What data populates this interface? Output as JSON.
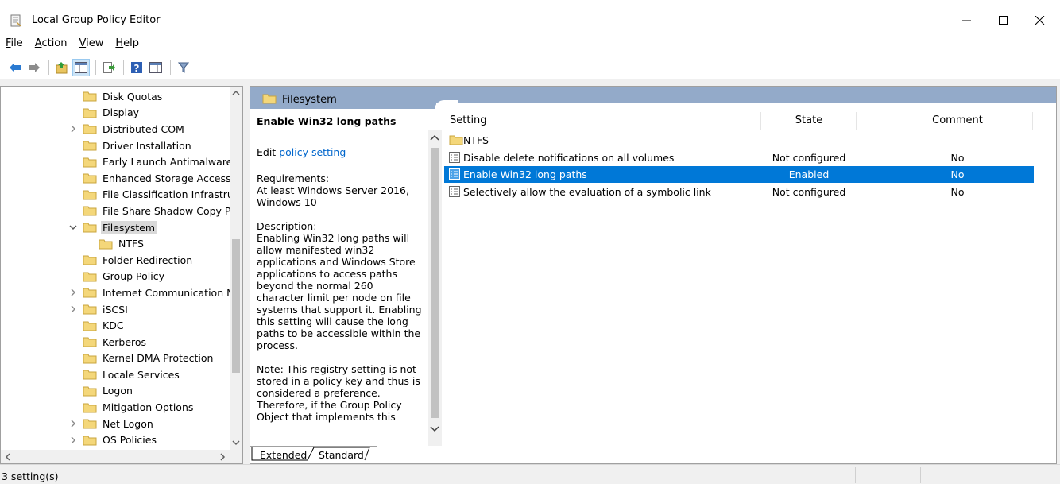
{
  "window": {
    "title": "Local Group Policy Editor",
    "icon": "policy-editor-icon",
    "controls": [
      "minimize-icon",
      "maximize-icon",
      "close-icon"
    ]
  },
  "menu": {
    "items": [
      {
        "label": "File",
        "accel": "F",
        "rest": "ile"
      },
      {
        "label": "Action",
        "accel": "A",
        "rest": "ction"
      },
      {
        "label": "View",
        "accel": "V",
        "rest": "iew"
      },
      {
        "label": "Help",
        "accel": "H",
        "rest": "elp"
      }
    ]
  },
  "toolbar": {
    "buttons": [
      "back-arrow-icon",
      "forward-arrow-icon",
      "up-folder-icon",
      "show-hide-tree-icon",
      "export-list-icon",
      "help-icon",
      "properties-view-icon",
      "filter-icon"
    ]
  },
  "tree": {
    "items": [
      {
        "label": "Disk Quotas",
        "expandable": false,
        "level": 0
      },
      {
        "label": "Display",
        "expandable": false,
        "level": 0
      },
      {
        "label": "Distributed COM",
        "expandable": true,
        "level": 0
      },
      {
        "label": "Driver Installation",
        "expandable": false,
        "level": 0
      },
      {
        "label": "Early Launch Antimalware",
        "expandable": false,
        "level": 0
      },
      {
        "label": "Enhanced Storage Access",
        "expandable": false,
        "level": 0
      },
      {
        "label": "File Classification Infrastruc",
        "expandable": false,
        "level": 0
      },
      {
        "label": "File Share Shadow Copy Pr",
        "expandable": false,
        "level": 0
      },
      {
        "label": "Filesystem",
        "expandable": true,
        "expanded": true,
        "selected": true,
        "level": 0
      },
      {
        "label": "NTFS",
        "expandable": false,
        "level": 1
      },
      {
        "label": "Folder Redirection",
        "expandable": false,
        "level": 0
      },
      {
        "label": "Group Policy",
        "expandable": false,
        "level": 0
      },
      {
        "label": "Internet Communication M",
        "expandable": true,
        "level": 0
      },
      {
        "label": "iSCSI",
        "expandable": true,
        "level": 0
      },
      {
        "label": "KDC",
        "expandable": false,
        "level": 0
      },
      {
        "label": "Kerberos",
        "expandable": false,
        "level": 0
      },
      {
        "label": "Kernel DMA Protection",
        "expandable": false,
        "level": 0
      },
      {
        "label": "Locale Services",
        "expandable": false,
        "level": 0
      },
      {
        "label": "Logon",
        "expandable": false,
        "level": 0
      },
      {
        "label": "Mitigation Options",
        "expandable": false,
        "level": 0
      },
      {
        "label": "Net Logon",
        "expandable": true,
        "level": 0
      },
      {
        "label": "OS Policies",
        "expandable": true,
        "level": 0
      }
    ]
  },
  "right": {
    "header": "Filesystem",
    "description": {
      "title": "Enable Win32 long paths",
      "edit_prefix": "Edit ",
      "edit_link": "policy setting ",
      "requirements_label": "Requirements:",
      "requirements": "At least Windows Server 2016, Windows 10",
      "description_label": "Description:",
      "description": "Enabling Win32 long paths will allow manifested win32 applications and Windows Store applications to access paths beyond the normal 260 character limit per node on file systems that support it.  Enabling this setting will cause the long paths to be accessible within the process.",
      "note": "Note:  This registry setting is not stored in a policy key and thus is considered a preference. Therefore, if the Group Policy Object that implements this"
    },
    "columns": {
      "setting": "Setting",
      "state": "State",
      "comment": "Comment"
    },
    "rows": [
      {
        "type": "folder",
        "name": "NTFS",
        "state": "",
        "comment": ""
      },
      {
        "type": "setting",
        "name": "Disable delete notifications on all volumes",
        "state": "Not configured",
        "comment": "No"
      },
      {
        "type": "setting",
        "name": "Enable Win32 long paths",
        "state": "Enabled",
        "comment": "No",
        "selected": true
      },
      {
        "type": "setting",
        "name": "Selectively allow the evaluation of a symbolic link",
        "state": "Not configured",
        "comment": "No"
      }
    ],
    "tabs": {
      "extended": "Extended",
      "standard": "Standard"
    }
  },
  "status": {
    "text": "3 setting(s)"
  },
  "colors": {
    "selection": "#0078d7",
    "header_band": "#93aac9",
    "folder": "#f4d77a"
  }
}
